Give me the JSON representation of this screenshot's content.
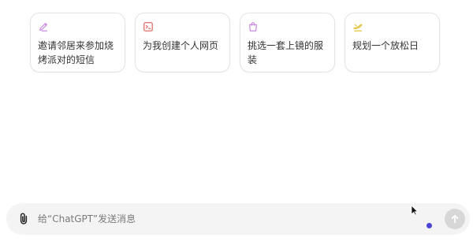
{
  "suggestions": [
    {
      "icon": "pencil-icon",
      "label": "邀请邻居来参加烧烤派对的短信",
      "color": "#c98ae0"
    },
    {
      "icon": "terminal-icon",
      "label": "为我创建个人网页",
      "color": "#e46a6a"
    },
    {
      "icon": "shopping-bag-icon",
      "label": "挑选一套上镜的服装",
      "color": "#c98ae0"
    },
    {
      "icon": "airplane-icon",
      "label": "规划一个放松日",
      "color": "#e2c541"
    }
  ],
  "composer": {
    "placeholder": "给“ChatGPT”发送消息",
    "value": ""
  },
  "colors": {
    "background": "#ffffff",
    "composer_bg": "#f4f4f4",
    "send_disabled": "#d7d7d7",
    "status_dot": "#4b45d6"
  }
}
